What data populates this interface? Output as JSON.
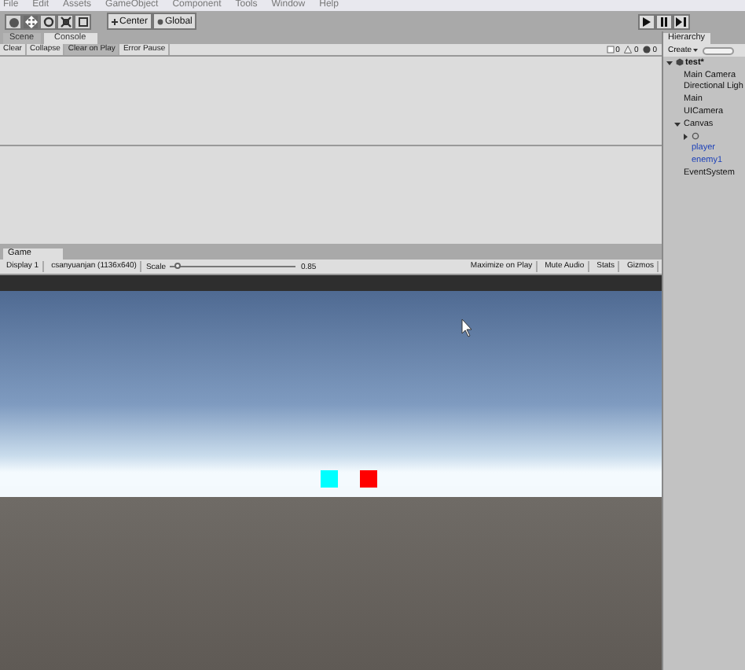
{
  "menu": [
    "File",
    "Edit",
    "Assets",
    "GameObject",
    "Component",
    "Tools",
    "Window",
    "Help"
  ],
  "toolbar": {
    "tools": [
      {
        "kind": "hand",
        "selected": false
      },
      {
        "kind": "move",
        "selected": true
      },
      {
        "kind": "rotate",
        "selected": false
      },
      {
        "kind": "scale",
        "selected": false
      },
      {
        "kind": "rect",
        "selected": false
      }
    ],
    "pivot": [
      {
        "kind": "pivot",
        "label": "Center"
      },
      {
        "kind": "space",
        "label": "Global"
      }
    ],
    "play": [
      {
        "kind": "play"
      },
      {
        "kind": "pause"
      },
      {
        "kind": "step"
      }
    ]
  },
  "console": {
    "tabs": [
      {
        "label": "Scene",
        "selected": false
      },
      {
        "label": "Console",
        "selected": true
      }
    ],
    "buttons": [
      {
        "label": "Clear",
        "on": false
      },
      {
        "label": "Collapse",
        "on": false
      },
      {
        "label": "Clear on Play",
        "on": true
      },
      {
        "label": "Error Pause",
        "on": false
      }
    ],
    "counts": [
      {
        "kind": "info",
        "count": "0"
      },
      {
        "kind": "warning",
        "count": "0"
      },
      {
        "kind": "error",
        "count": "0"
      }
    ]
  },
  "game": {
    "tab": "Game",
    "display": "Display 1",
    "resolution": "csanyuanjan (1136x640)",
    "scale_label": "Scale",
    "scale": {
      "level": 0.03
    },
    "scale_reading": "0.85",
    "buttons": [
      {
        "label": "Maximize on Play",
        "on": false
      },
      {
        "label": "Mute Audio",
        "on": false
      },
      {
        "label": "Stats",
        "on": false
      },
      {
        "label": "Gizmos",
        "on": false
      }
    ],
    "objects": [
      {
        "color": "#00ffff"
      },
      {
        "color": "#ff0000"
      }
    ]
  },
  "hierarchy": {
    "title": "Hierarchy",
    "create": "Create",
    "tree": [
      {
        "name": "test*",
        "kind": "scene",
        "expanded": true,
        "children": [
          {
            "name": "Main Camera",
            "prefab": false
          },
          {
            "name": "Directional Ligh",
            "prefab": false
          },
          {
            "name": "Main",
            "prefab": false
          },
          {
            "name": "UICamera",
            "prefab": false
          },
          {
            "name": "Canvas",
            "prefab": false,
            "expanded": true,
            "children": [
              {
                "kind": "unnamed",
                "expanded": false
              },
              {
                "name": "player",
                "prefab": true
              },
              {
                "name": "enemy1",
                "prefab": true
              }
            ]
          },
          {
            "name": "EventSystem",
            "prefab": false
          }
        ]
      }
    ]
  }
}
